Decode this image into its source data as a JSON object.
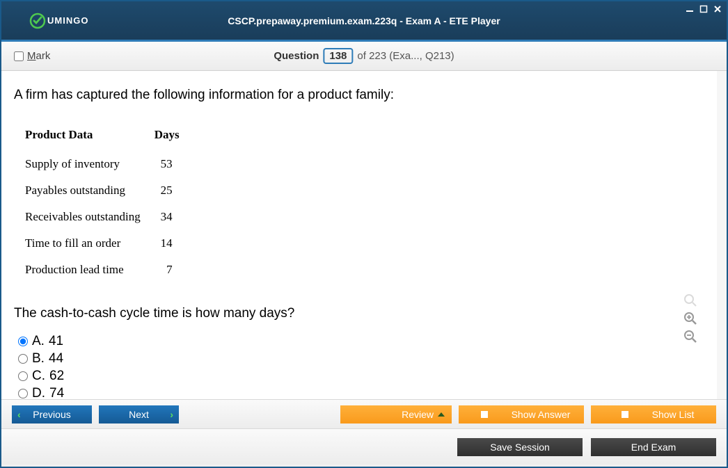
{
  "window": {
    "brand": "UMINGO",
    "title": "CSCP.prepaway.premium.exam.223q - Exam A - ETE Player"
  },
  "questionBar": {
    "mark_label": "Mark",
    "question_label": "Question",
    "current": "138",
    "total_suffix": "of 223 (Exa..., Q213)"
  },
  "content": {
    "prompt": "A firm has captured the following information for a product family:",
    "table": {
      "headers": [
        "Product Data",
        "Days"
      ],
      "rows": [
        {
          "label": "Supply of inventory",
          "days": "53"
        },
        {
          "label": "Payables outstanding",
          "days": "25"
        },
        {
          "label": "Receivables outstanding",
          "days": "34"
        },
        {
          "label": "Time to fill an order",
          "days": "14"
        },
        {
          "label": "Production lead time",
          "days": "7"
        }
      ]
    },
    "sub_question": "The cash-to-cash cycle time is how many days?",
    "options": [
      {
        "letter": "A.",
        "value": "41",
        "selected": true
      },
      {
        "letter": "B.",
        "value": "44",
        "selected": false
      },
      {
        "letter": "C.",
        "value": "62",
        "selected": false
      },
      {
        "letter": "D.",
        "value": "74",
        "selected": false
      }
    ]
  },
  "footer": {
    "previous": "Previous",
    "next": "Next",
    "review": "Review",
    "show_answer": "Show Answer",
    "show_list": "Show List",
    "save_session": "Save Session",
    "end_exam": "End Exam"
  }
}
